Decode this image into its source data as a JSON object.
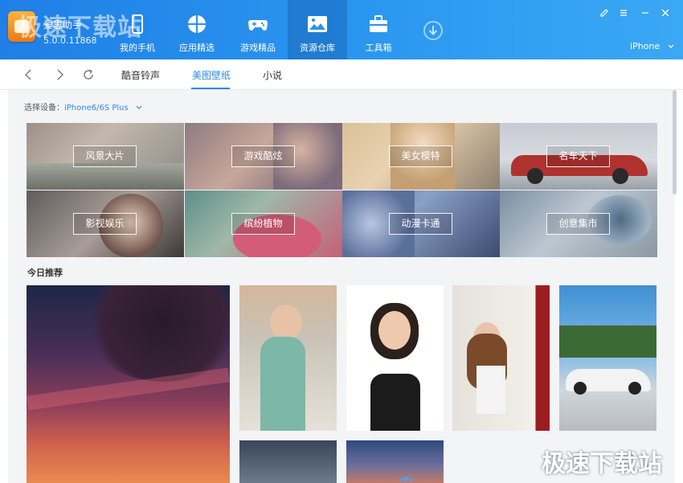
{
  "app": {
    "name": "爱思助手",
    "version": "5.0.0.11868",
    "watermark": "极速下载站"
  },
  "nav": [
    {
      "label": "我的手机",
      "icon": "phone-icon"
    },
    {
      "label": "应用精选",
      "icon": "apps-icon"
    },
    {
      "label": "游戏精品",
      "icon": "gamepad-icon"
    },
    {
      "label": "资源仓库",
      "icon": "image-icon",
      "active": true
    },
    {
      "label": "工具箱",
      "icon": "toolbox-icon"
    }
  ],
  "window": {
    "device": "iPhone"
  },
  "tabs": [
    {
      "label": "酷音铃声"
    },
    {
      "label": "美图壁纸",
      "active": true
    },
    {
      "label": "小说"
    }
  ],
  "device_picker": {
    "label": "选择设备：",
    "value": "iPhone6/6S Plus"
  },
  "categories": [
    {
      "label": "风景大片"
    },
    {
      "label": "游戏酷炫"
    },
    {
      "label": "美女模特"
    },
    {
      "label": "名车天下"
    },
    {
      "label": "影视娱乐"
    },
    {
      "label": "缤纷植物"
    },
    {
      "label": "动漫卡通"
    },
    {
      "label": "创意集市"
    }
  ],
  "recommend": {
    "title": "今日推荐"
  },
  "colors": {
    "accent": "#2a8be8",
    "header_start": "#1f7fe6",
    "header_end": "#3aa8f4"
  }
}
